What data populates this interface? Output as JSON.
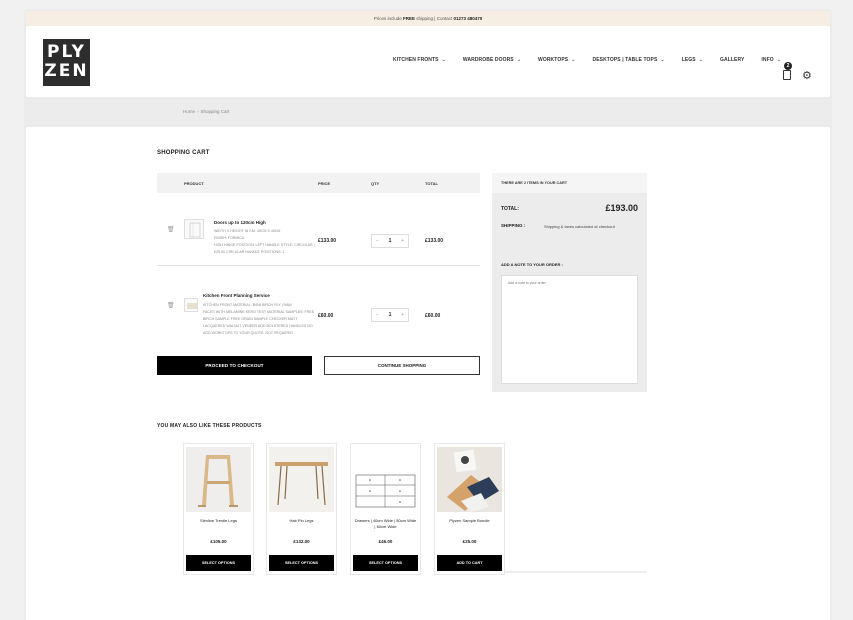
{
  "topbar": {
    "pre": "Prices include ",
    "free": "FREE",
    "mid": " shipping | Contact ",
    "phone": "01273 480470"
  },
  "logo": {
    "line1": "PLY",
    "line2": "ZEN"
  },
  "nav": [
    {
      "label": "KITCHEN FRONTS",
      "chevron": true
    },
    {
      "label": "WARDROBE DOORS",
      "chevron": true
    },
    {
      "label": "WORKTOPS",
      "chevron": true
    },
    {
      "label": "DESKTOPS | TABLE TOPS",
      "chevron": true
    },
    {
      "label": "LEGS",
      "chevron": true
    },
    {
      "label": "GALLERY",
      "chevron": false
    },
    {
      "label": "INFO",
      "chevron": true
    }
  ],
  "cart_count": "2",
  "breadcrumb": {
    "home": "Home",
    "sep": "›",
    "current": "Shopping Cart"
  },
  "cart": {
    "title": "SHOPPING CART",
    "headers": {
      "product": "PRODUCT",
      "price": "PRICE",
      "qty": "QTY",
      "total": "TOTAL"
    },
    "items": [
      {
        "title": "Doors up to 120cm High",
        "meta": [
          "WIDTH X HEIGHT IN CM: 40CM X 40CM",
          "FINISH: FORMICA",
          "HIGH HINGE POSITION: LEFT HANDLE STYLE: CIRCULAR | £25.00 CIRCULAR HANDLE POSITIONS: 1"
        ],
        "price": "£133.00",
        "qty": "1",
        "total": "£133.00"
      },
      {
        "title": "Kitchen Front Planning Service",
        "meta": [
          "KITCHEN FRONT MATERIAL: B/BB BIRCH PLY | RAW",
          "FACES WITH MELAMINE KERO TEST MATERIAL SAMPLES: FREE BIRCH SAMPLE FREE GRAIN SAMPLE CHECKER MATT LACQUERED WALNUT VENEER ADD BOLSTERED HANDLES NO ADD WORKTOPS TO YOUR QUOTE: NOT REQUIRED"
        ],
        "price": "£60.00",
        "qty": "1",
        "total": "£60.00"
      }
    ],
    "checkout_label": "PROCEED TO CHECKOUT",
    "continue_label": "CONTINUE SHOPPING"
  },
  "summary": {
    "header": "THERE ARE 2 ITEMS IN YOUR CART",
    "total_label": "TOTAL:",
    "total_value": "£193.00",
    "shipping_label": "SHIPPING :",
    "shipping_value": "Shipping & taxes calculated at checkout",
    "note_label": "ADD A NOTE TO YOUR ORDER :",
    "note_placeholder": "Add a note to your order"
  },
  "recommend": {
    "title": "YOU MAY ALSO LIKE THESE PRODUCTS",
    "products": [
      {
        "name": "Slimline Trestle Legs",
        "price": "£105.00",
        "button": "SELECT OPTIONS"
      },
      {
        "name": "Hair Pin Legs",
        "price": "£132.00",
        "button": "SELECT OPTIONS"
      },
      {
        "name": "Drawers | 40cm Wide | 50cm Wide | 60cm Wide",
        "price": "£46.00",
        "button": "SELECT OPTIONS"
      },
      {
        "name": "Plyzen Sample Bundle",
        "price": "£25.00",
        "button": "ADD TO CART"
      }
    ]
  }
}
